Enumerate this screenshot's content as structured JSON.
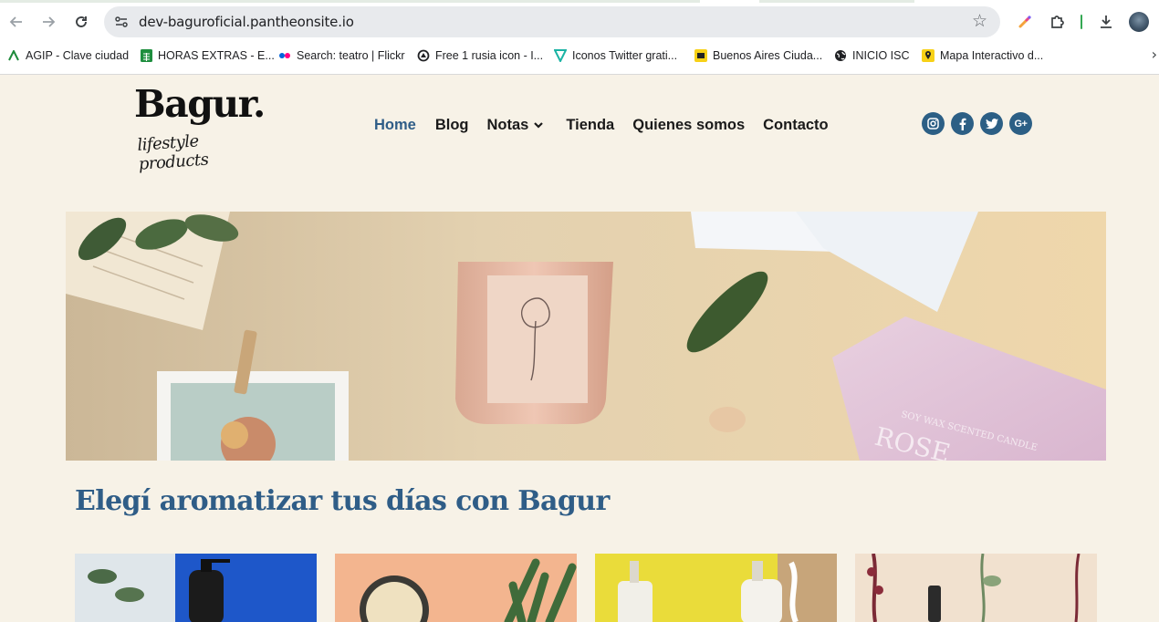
{
  "browser": {
    "url": "dev-baguroficial.pantheonsite.io",
    "icons": {
      "back": "back-arrow-icon",
      "forward": "forward-arrow-icon",
      "reload": "reload-icon",
      "site_info": "site-settings-icon",
      "bookmark_star": "star-icon",
      "extension_color": "color-picker-extension-icon",
      "extensions": "puzzle-icon",
      "download": "download-icon",
      "profile": "profile-avatar"
    },
    "bookmarks": [
      {
        "label": "AGIP - Clave ciudad",
        "icon": "agip-icon"
      },
      {
        "label": "HORAS EXTRAS - E...",
        "icon": "sheets-icon"
      },
      {
        "label": "Search: teatro | Flickr",
        "icon": "flickr-icon"
      },
      {
        "label": "Free 1 rusia icon - I...",
        "icon": "flaticon-icon"
      },
      {
        "label": "Iconos Twitter grati...",
        "icon": "freepik-icon"
      },
      {
        "label": "Buenos Aires Ciuda...",
        "icon": "ba-ciudad-icon"
      },
      {
        "label": "INICIO ISC",
        "icon": "globe-icon"
      },
      {
        "label": "Mapa Interactivo d...",
        "icon": "map-pin-icon"
      }
    ]
  },
  "site": {
    "logo": {
      "word": "Bagur.",
      "tagline": "lifestyle products"
    },
    "menu": [
      {
        "label": "Home",
        "active": true
      },
      {
        "label": "Blog",
        "active": false
      },
      {
        "label": "Notas",
        "active": false,
        "has_dropdown": true
      },
      {
        "label": "Tienda",
        "active": false
      },
      {
        "label": "Quienes somos",
        "active": false
      },
      {
        "label": "Contacto",
        "active": false
      }
    ],
    "social": [
      {
        "name": "instagram-icon",
        "glyph": "◎"
      },
      {
        "name": "facebook-icon",
        "glyph": "f"
      },
      {
        "name": "twitter-icon",
        "glyph": "🐦"
      },
      {
        "name": "google-plus-icon",
        "glyph": "G+"
      }
    ],
    "hero": {
      "box_text_line1": "SOY WAX SCENTED CANDLE",
      "box_text_line2": "ROSE"
    },
    "headline": "Elegí aromatizar tus días con Bagur",
    "colors": {
      "accent": "#2f5d87",
      "social_bg": "#2c5f85",
      "background": "#f7f2e7"
    }
  }
}
